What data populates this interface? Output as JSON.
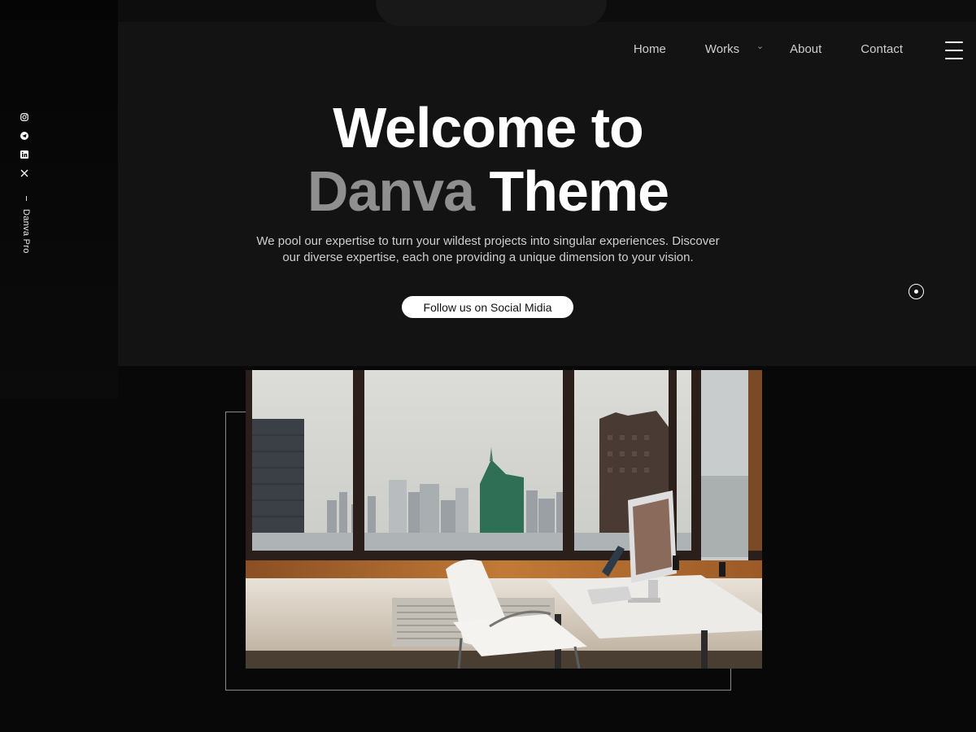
{
  "sidebar": {
    "social_icons": [
      "instagram-icon",
      "telegram-icon",
      "linkedin-icon",
      "x-icon"
    ],
    "brand_vertical": "Danva Pro"
  },
  "nav": {
    "items": [
      {
        "label": "Home"
      },
      {
        "label": "Works",
        "has_dropdown": true
      },
      {
        "label": "About"
      },
      {
        "label": "Contact"
      }
    ],
    "menu_icon": "hamburger-icon"
  },
  "hero": {
    "headline_line1": "Welcome to",
    "headline_dim": "Danva",
    "headline_rest": " Theme",
    "description": "We pool our expertise to turn your wildest projects into singular experiences. Discover our diverse expertise, each one providing a unique dimension to your vision.",
    "cta_label": "Follow us on Social Midia"
  },
  "colors": {
    "background": "#080808",
    "panel": "#131313",
    "dim_text": "#8f8f8f",
    "cta_bg": "#ffffff"
  },
  "image": {
    "icon": "office-photo"
  }
}
